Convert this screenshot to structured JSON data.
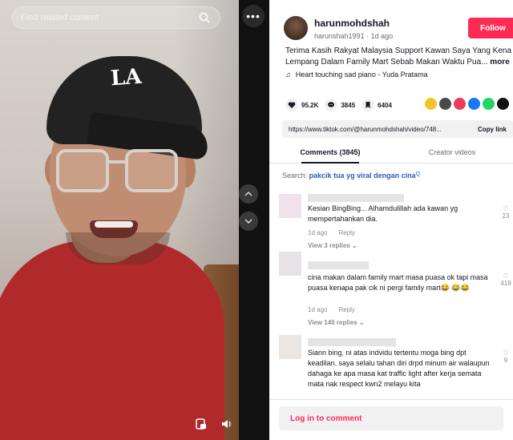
{
  "video": {
    "search_placeholder": "Find related content",
    "logo_text": "LA"
  },
  "author": {
    "username": "harunmohdshah",
    "handle": "harunshah1991",
    "time": "1d ago",
    "follow_label": "Follow",
    "caption": "Terima Kasih Rakyat Malaysia Support Kawan Saya Yang Kena Lempang Dalam Family Mart Sebab Makan Waktu Pua...",
    "caption_more": "more",
    "music": "Heart touching sad piano - Yuda Pratama"
  },
  "stats": {
    "likes": "95.2K",
    "comments": "3845",
    "saves": "6404"
  },
  "share_colors": [
    "#f5c32c",
    "#ef3b5a",
    "#2aa245",
    "#1877f2",
    "#25d366",
    "#111111"
  ],
  "url": {
    "value": "https://www.tiktok.com/@harunmohdshah/video/748...",
    "copy_label": "Copy link"
  },
  "tabs": [
    {
      "label": "Comments (3845)",
      "active": true
    },
    {
      "label": "Creator videos",
      "active": false
    }
  ],
  "related": {
    "prefix": "Search:",
    "query": "pakcik tua yg viral dengan cina"
  },
  "comments": [
    {
      "text": "Kesian BingBing... Alhamdulillah ada kawan yg mempertahankan dia.",
      "time": "1d ago",
      "reply": "Reply",
      "replies": "View 3 replies",
      "likes": "23"
    },
    {
      "text": "cina makan dalam family mart masa puasa ok tapi masa puasa kenapa pak cik ni pergi family mart😂 😂😂",
      "time": "1d ago",
      "reply": "Reply",
      "replies": "View 140 replies",
      "likes": "418"
    },
    {
      "text": "Siann bing. ni atas indvidu tertentu moga bing dpt keadilan. saya selalu tahan diri drpd minum air walaupun dahaga ke apa masa kat traffic light after kerja semata mata nak respect kwn2 melayu kita",
      "likes": "9"
    }
  ],
  "login_label": "Log in to comment"
}
